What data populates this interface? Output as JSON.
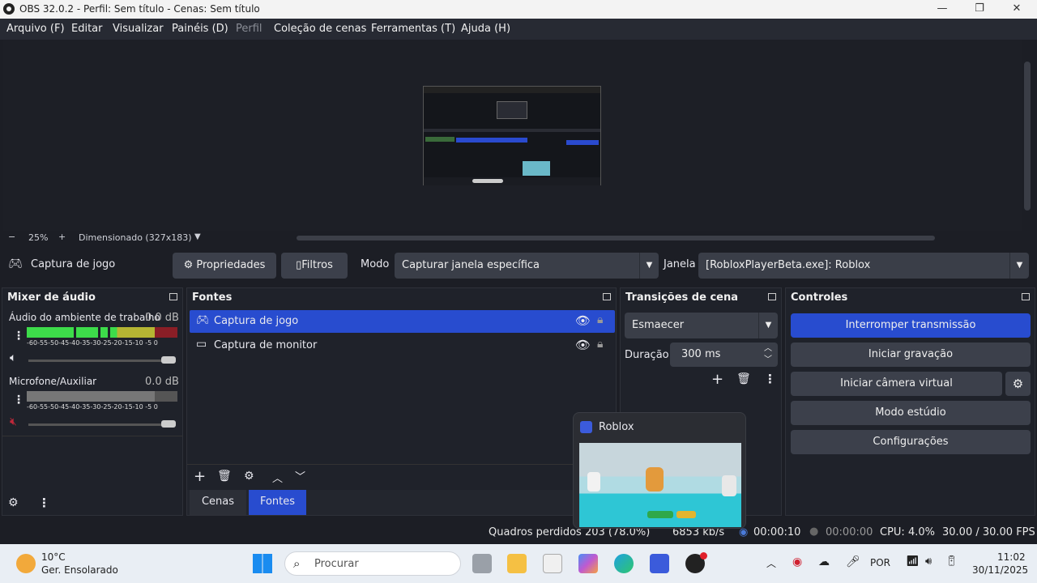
{
  "window": {
    "title": "OBS 32.0.2 - Perfil: Sem título - Cenas: Sem título"
  },
  "menu": [
    "Arquivo (F)",
    "Editar",
    "Visualizar",
    "Painéis (D)",
    "Perfil",
    "Coleção de cenas",
    "Ferramentas (T)",
    "Ajuda (H)"
  ],
  "zoom": {
    "minus": "−",
    "level": "25%",
    "plus": "+",
    "scaled": "Dimensionado (327x183)"
  },
  "source_toolbar": {
    "name": "Captura de jogo",
    "properties": "Propriedades",
    "filters": "Filtros",
    "mode_label": "Modo",
    "mode_value": "Capturar janela específica",
    "window_label": "Janela",
    "window_value": "[RobloxPlayerBeta.exe]: Roblox"
  },
  "mixer": {
    "title": "Mixer de áudio",
    "scale": "-60-55-50-45-40-35-30-25-20-15-10 -5  0",
    "channels": [
      {
        "name": "Áudio do ambiente de trabalho",
        "db": "0.0 dB",
        "muted": false
      },
      {
        "name": "Microfone/Auxiliar",
        "db": "0.0 dB",
        "muted": true
      }
    ]
  },
  "sources": {
    "title": "Fontes",
    "items": [
      {
        "name": "Captura de jogo",
        "selected": true
      },
      {
        "name": "Captura de monitor",
        "selected": false
      }
    ],
    "tabs": [
      "Cenas",
      "Fontes"
    ]
  },
  "transitions": {
    "title": "Transições de cena",
    "type": "Esmaecer",
    "duration_label": "Duração",
    "duration_value": "300 ms"
  },
  "controls": {
    "title": "Controles",
    "stop_stream": "Interromper transmissão",
    "start_recording": "Iniciar gravação",
    "virtual_camera": "Iniciar câmera virtual",
    "studio_mode": "Modo estúdio",
    "settings": "Configurações"
  },
  "popup": {
    "title": "Roblox"
  },
  "status": {
    "dropped_frames": "Quadros perdidos 203 (78.0%)",
    "kbps": "6853 kb/s",
    "stream_time": "00:00:10",
    "rec_time": "00:00:00",
    "cpu": "CPU: 4.0%",
    "fps": "30.00 / 30.00 FPS"
  },
  "taskbar": {
    "temp": "10°C",
    "weather": "Ger. Ensolarado",
    "search_placeholder": "Procurar",
    "lang": "POR",
    "time": "11:02",
    "date": "30/11/2025"
  },
  "colors": {
    "accent": "#284ccf",
    "meter_green": "#3ddc4a",
    "meter_yellow": "#b5b533",
    "meter_red": "#8a1e26"
  }
}
